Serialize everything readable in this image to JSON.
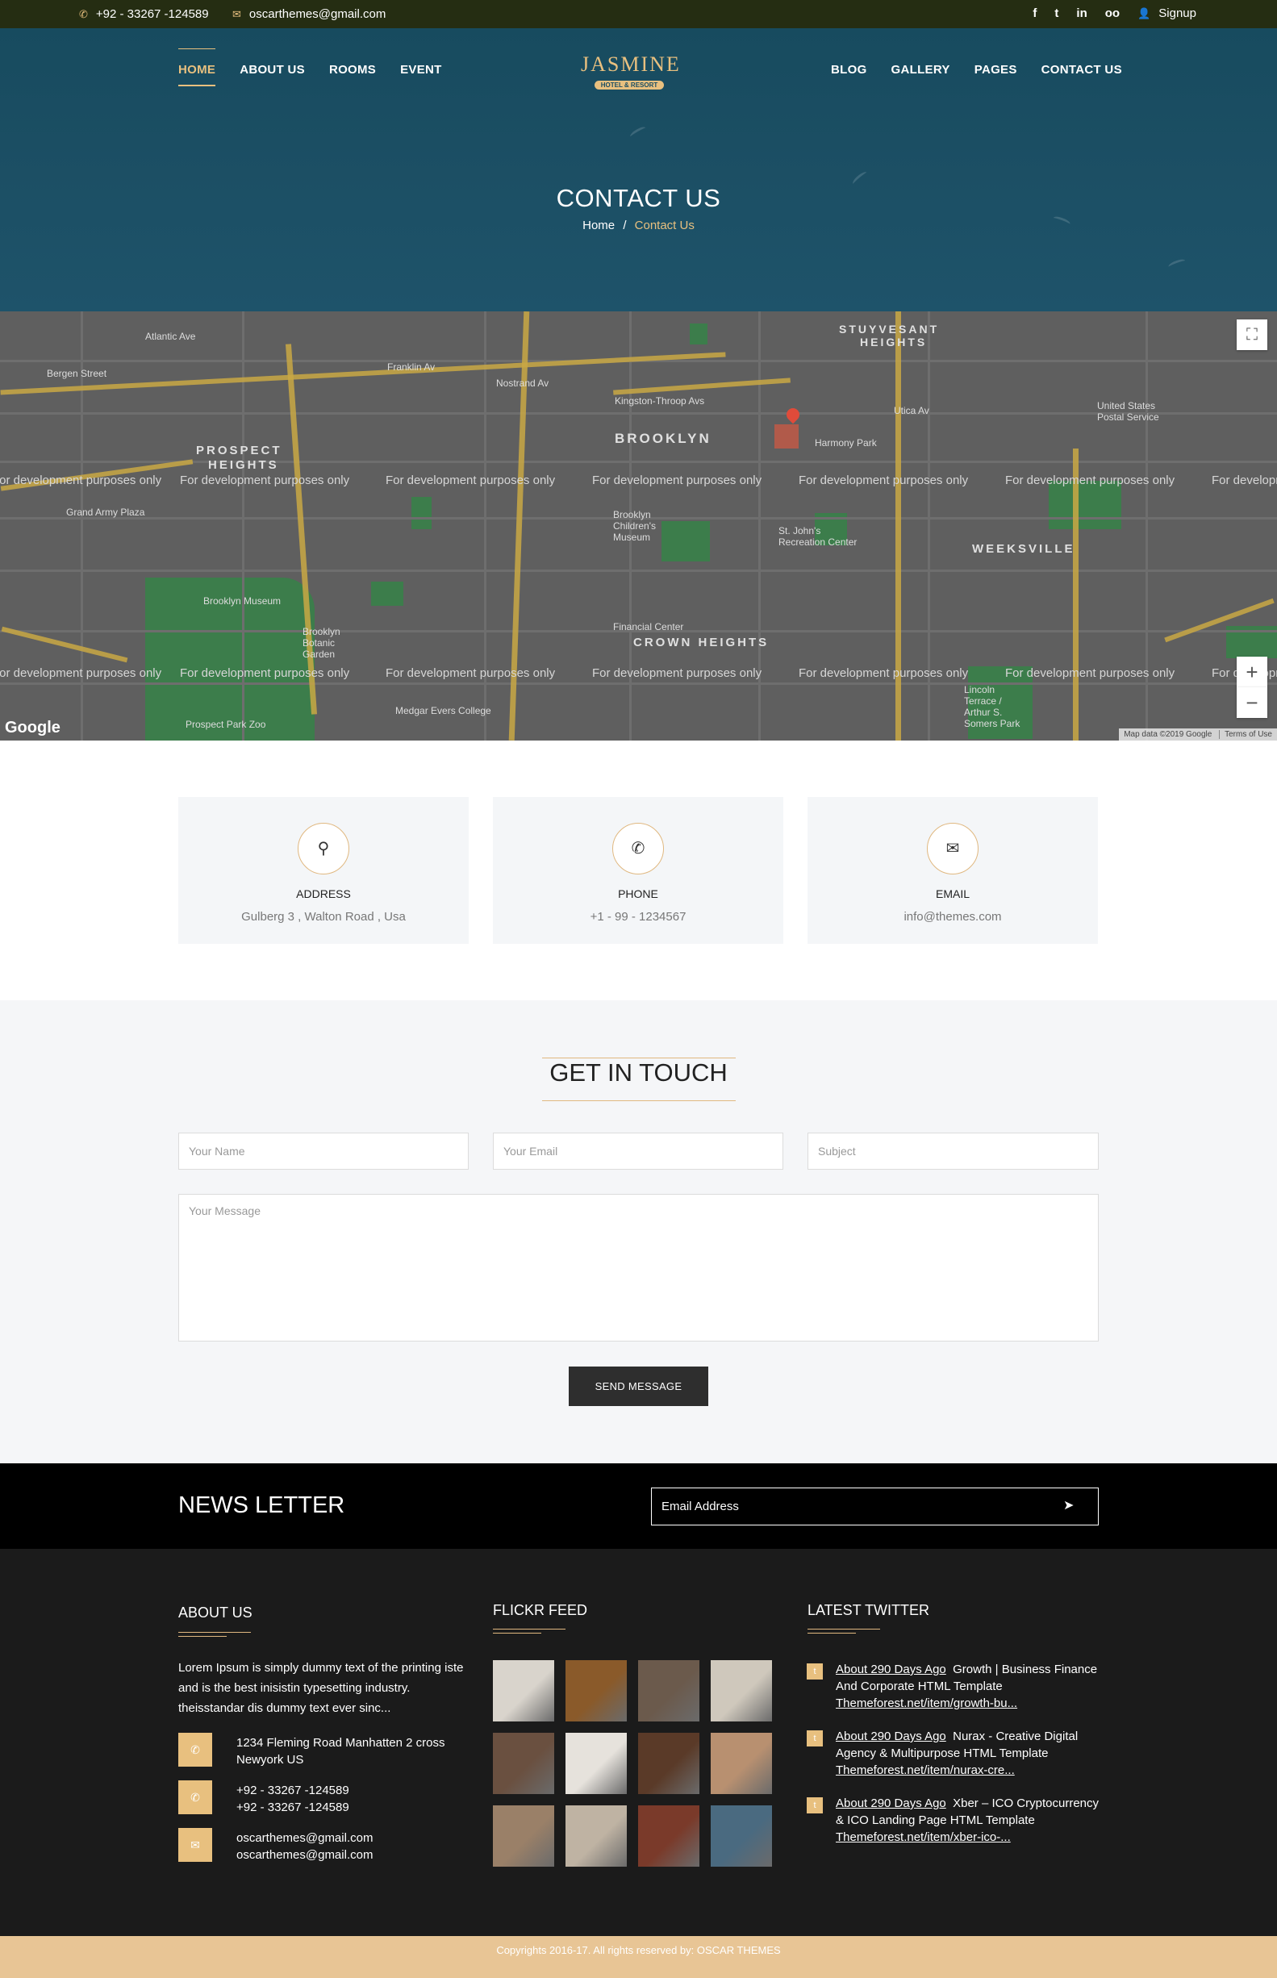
{
  "topbar": {
    "phone": "+92 - 33267 -124589",
    "email": "oscarthemes@gmail.com",
    "signup": "Signup",
    "social": [
      "f",
      "t",
      "in",
      "oo"
    ]
  },
  "nav": {
    "left": [
      "HOME",
      "ABOUT US",
      "ROOMS",
      "EVENT"
    ],
    "right": [
      "BLOG",
      "GALLERY",
      "PAGES",
      "CONTACT US"
    ],
    "active": "HOME"
  },
  "logo": {
    "main": "JASMINE",
    "sub": "HOTEL & RESORT"
  },
  "hero": {
    "title": "CONTACT US",
    "breadcrumb_home": "Home",
    "breadcrumb_sep": "/",
    "breadcrumb_current": "Contact Us"
  },
  "map": {
    "dev_notice": "For development purposes only",
    "brand": "Google",
    "attribution": "Map data ©2019 Google",
    "terms": "Terms of Use",
    "zoom_in": "+",
    "zoom_out": "−",
    "labels": {
      "stuyvesant": "STUYVESANT",
      "heights": "HEIGHTS",
      "brooklyn": "BROOKLYN",
      "prospect": "PROSPECT",
      "heights2": "HEIGHTS",
      "crown": "CROWN HEIGHTS",
      "weeksville": "WEEKSVILLE",
      "atlantic": "Atlantic Ave",
      "franklin": "Franklin Av",
      "nostrand": "Nostrand Av",
      "kingston": "Kingston-Throop Avs",
      "bergen": "Bergen Street",
      "grand_army": "Grand Army Plaza",
      "museum": "Brooklyn Museum",
      "botanic": "Brooklyn Botanic Garden",
      "harmony": "Harmony Park",
      "utica": "Utica Av",
      "medgar": "Medgar Evers College",
      "zoo": "Prospect Park Zoo",
      "recreation": "St. John's Recreation Center",
      "lincoln": "Lincoln Terrace / Arthur S. Somers Park",
      "childrens": "Brooklyn Children's Museum",
      "financial": "Financial Center",
      "postal": "United States Postal Service"
    }
  },
  "cards": [
    {
      "icon": "map-marker-icon",
      "glyph": "⚲",
      "title": "ADDRESS",
      "value": "Gulberg 3 , Walton Road , Usa"
    },
    {
      "icon": "phone-icon",
      "glyph": "✆",
      "title": "PHONE",
      "value": "+1 - 99 - 1234567"
    },
    {
      "icon": "envelope-icon",
      "glyph": "✉",
      "title": "EMAIL",
      "value": "info@themes.com"
    }
  ],
  "contact_form": {
    "title": "GET IN TOUCH",
    "name_placeholder": "Your Name",
    "email_placeholder": "Your Email",
    "subject_placeholder": "Subject",
    "message_placeholder": "Your Message",
    "send_label": "SEND MESSAGE"
  },
  "newsletter": {
    "title": "NEWS LETTER",
    "placeholder": "Email Address",
    "send_icon": "paper-plane-icon"
  },
  "footer": {
    "about": {
      "title": "ABOUT US",
      "text": "Lorem Ipsum is simply dummy text of the printing iste and is the best inisistin typesetting industry. theisstandar dis dummy text ever sinc...",
      "address_line1": "1234 Fleming Road Manhatten 2 cross",
      "address_line2": "Newyork US",
      "phone_line1": "+92 - 33267 -124589",
      "phone_line2": "+92 - 33267 -124589",
      "email_line1": "oscarthemes@gmail.com",
      "email_line2": "oscarthemes@gmail.com"
    },
    "flickr": {
      "title": "FLICKR FEED",
      "thumbs": [
        "#d9d4cc",
        "#8a5a2a",
        "#6b5a4c",
        "#cfc8bc",
        "#6a5040",
        "#e6e2dc",
        "#5a3a28",
        "#b89070",
        "#9a8068",
        "#bfb3a3",
        "#7a3a2a",
        "#4a6a80"
      ]
    },
    "twitter": {
      "title": "LATEST TWITTER",
      "items": [
        {
          "ago": "About 290 Days Ago",
          "text": "Growth | Business Finance And Corporate HTML Template",
          "link": "Themeforest.net/item/growth-bu..."
        },
        {
          "ago": "About 290 Days Ago",
          "text": "Nurax - Creative Digital Agency & Multipurpose HTML Template",
          "link": "Themeforest.net/item/nurax-cre..."
        },
        {
          "ago": "About 290 Days Ago",
          "text": "Xber – ICO Cryptocurrency & ICO Landing Page HTML Template",
          "link": "Themeforest.net/item/xber-ico-..."
        }
      ]
    },
    "copyright": "Copyrights 2016-17. All rights reserved by: OSCAR THEMES"
  },
  "colors": {
    "accent": "#e8c07f",
    "topbar_bg": "#252d12",
    "hero_bg": "#1b4e63",
    "footer_bg": "#1b1b1b",
    "copyright_bg": "#e8c595"
  }
}
